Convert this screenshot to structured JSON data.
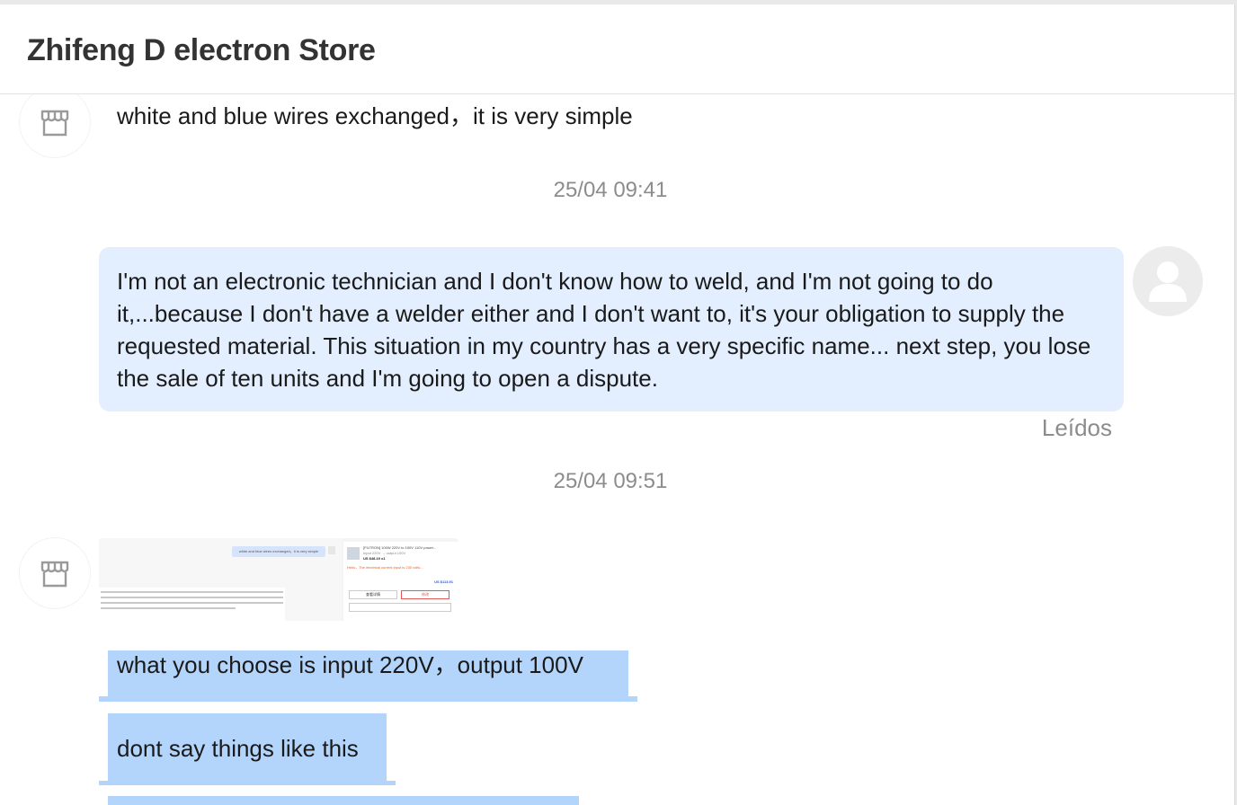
{
  "header": {
    "title": "Zhifeng D electron Store"
  },
  "messages": {
    "store_prev": "white and blue wires exchanged，it is very simple",
    "time1": "25/04 09:41",
    "user_msg": "I'm not an electronic technician and I don't know how to weld, and I'm not going to do it,...because I don't have a welder either and I don't want to, it's your obligation to supply the requested material. This situation in my country has a very specific name... next step, you lose the sale of ten units and I'm going to open a dispute.",
    "read_status": "Leídos",
    "time2": "25/04 09:51",
    "store_msg1": "what you choose is input 220V，output 100V",
    "store_msg2": "dont say things like this"
  },
  "thumbnail": {
    "bubble_text": "white and blue wires exchanged，it is very simple",
    "product_title": "[FILTRON] 100W 220V to 100V 110V power...",
    "product_sub": "Input 220V → output 100V",
    "product_price": "US $48.19 x1",
    "warning": "Hello，The electrical current input is 230 volts...",
    "total": "US $113.91",
    "btn1": "查看详情",
    "btn2": "修改"
  },
  "icons": {
    "store_avatar": "storefront-icon",
    "user_avatar": "user-silhouette-icon"
  },
  "colors": {
    "user_bubble": "#e3efff",
    "selection": "#b4d5fb",
    "timestamp": "#8c8c8c"
  }
}
